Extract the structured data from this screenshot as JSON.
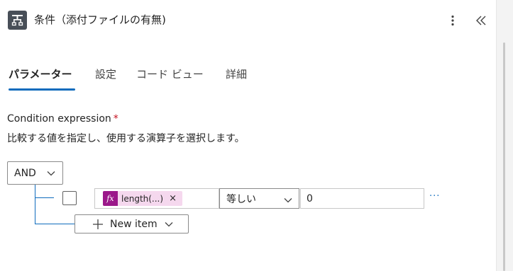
{
  "header": {
    "title": "条件（添付ファイルの有無)",
    "icon": "condition-icon",
    "more_icon": "more-vertical-icon",
    "collapse_icon": "double-chevron-left-icon"
  },
  "tabs": [
    {
      "label": "パラメーター",
      "active": true
    },
    {
      "label": "設定",
      "active": false
    },
    {
      "label": "コード ビュー",
      "active": false
    },
    {
      "label": "詳細",
      "active": false
    }
  ],
  "condition": {
    "label": "Condition expression",
    "required_marker": "*",
    "description": "比較する値を指定し、使用する演算子を選択します。",
    "group_operator": "AND",
    "rows": [
      {
        "checked": false,
        "left_operand": {
          "fx_icon": "fx",
          "text": "length(...)",
          "remove": "×"
        },
        "operator": "等しい",
        "right_operand": "0",
        "more": "···"
      }
    ],
    "new_item_label": "New item"
  },
  "colors": {
    "accent": "#0f6cbd",
    "token_bg": "#f5d8ee",
    "fx_bg": "#9b188a",
    "required": "#c50f1f",
    "header_icon_bg": "#484f58"
  }
}
